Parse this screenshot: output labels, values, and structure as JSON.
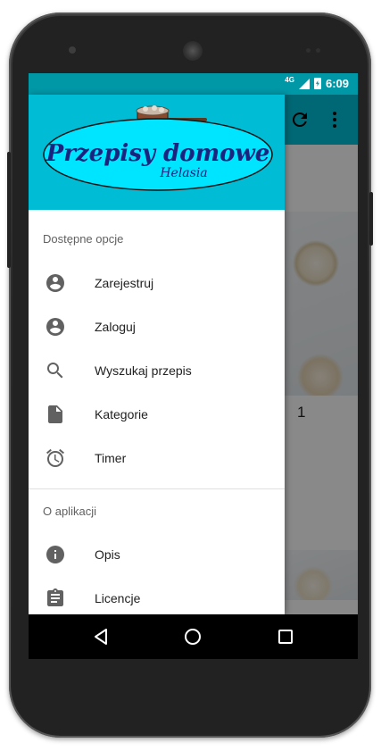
{
  "status_bar": {
    "network": "4G",
    "time": "6:09"
  },
  "toolbar": {
    "refresh_icon": "refresh-icon",
    "overflow_icon": "more-vert-icon",
    "accent_color": "#00bcd4",
    "status_color": "#0097a7"
  },
  "background_content": {
    "recipe_number": "1"
  },
  "drawer": {
    "logo": {
      "title": "Przepisy domowe",
      "subtitle": "Helasia"
    },
    "sections": [
      {
        "label": "Dostępne opcje",
        "items": [
          {
            "label": "Zarejestruj",
            "icon": "account-circle-icon"
          },
          {
            "label": "Zaloguj",
            "icon": "account-circle-icon"
          },
          {
            "label": "Wyszukaj przepis",
            "icon": "search-icon"
          },
          {
            "label": "Kategorie",
            "icon": "file-icon"
          },
          {
            "label": "Timer",
            "icon": "alarm-icon"
          }
        ]
      },
      {
        "label": "O aplikacji",
        "items": [
          {
            "label": "Opis",
            "icon": "info-icon"
          },
          {
            "label": "Licencje",
            "icon": "clipboard-icon"
          }
        ]
      }
    ]
  },
  "nav_bar": {
    "back_icon": "back-icon",
    "home_icon": "home-icon",
    "recents_icon": "recents-icon"
  }
}
